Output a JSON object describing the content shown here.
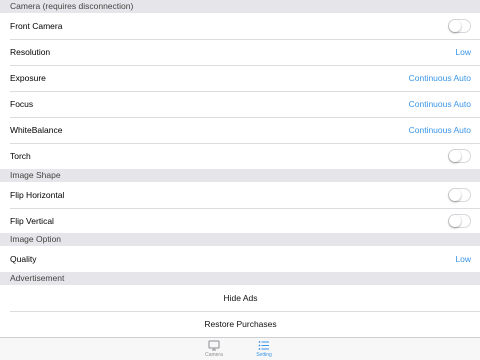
{
  "sections": {
    "camera": {
      "header": "Camera (requires disconnection)",
      "front_camera": {
        "label": "Front Camera",
        "on": false
      },
      "resolution": {
        "label": "Resolution",
        "value": "Low"
      },
      "exposure": {
        "label": "Exposure",
        "value": "Continuous Auto"
      },
      "focus": {
        "label": "Focus",
        "value": "Continuous Auto"
      },
      "white_balance": {
        "label": "WhiteBalance",
        "value": "Continuous Auto"
      },
      "torch": {
        "label": "Torch",
        "on": false
      }
    },
    "image_shape": {
      "header": "Image Shape",
      "flip_horizontal": {
        "label": "Flip Horizontal",
        "on": false
      },
      "flip_vertical": {
        "label": "Flip Vertical",
        "on": false
      }
    },
    "image_option": {
      "header": "Image Option",
      "quality": {
        "label": "Quality",
        "value": "Low"
      }
    },
    "advertisement": {
      "header": "Advertisement",
      "hide_ads": "Hide Ads",
      "restore_purchases": "Restore Purchases"
    }
  },
  "tabbar": {
    "camera": {
      "label": "Camera",
      "icon": "monitor-icon",
      "selected": false
    },
    "setting": {
      "label": "Setting",
      "icon": "list-icon",
      "selected": true
    }
  },
  "colors": {
    "accent": "#3a95e8",
    "background": "#efeff4",
    "header": "#e6e6ea"
  }
}
